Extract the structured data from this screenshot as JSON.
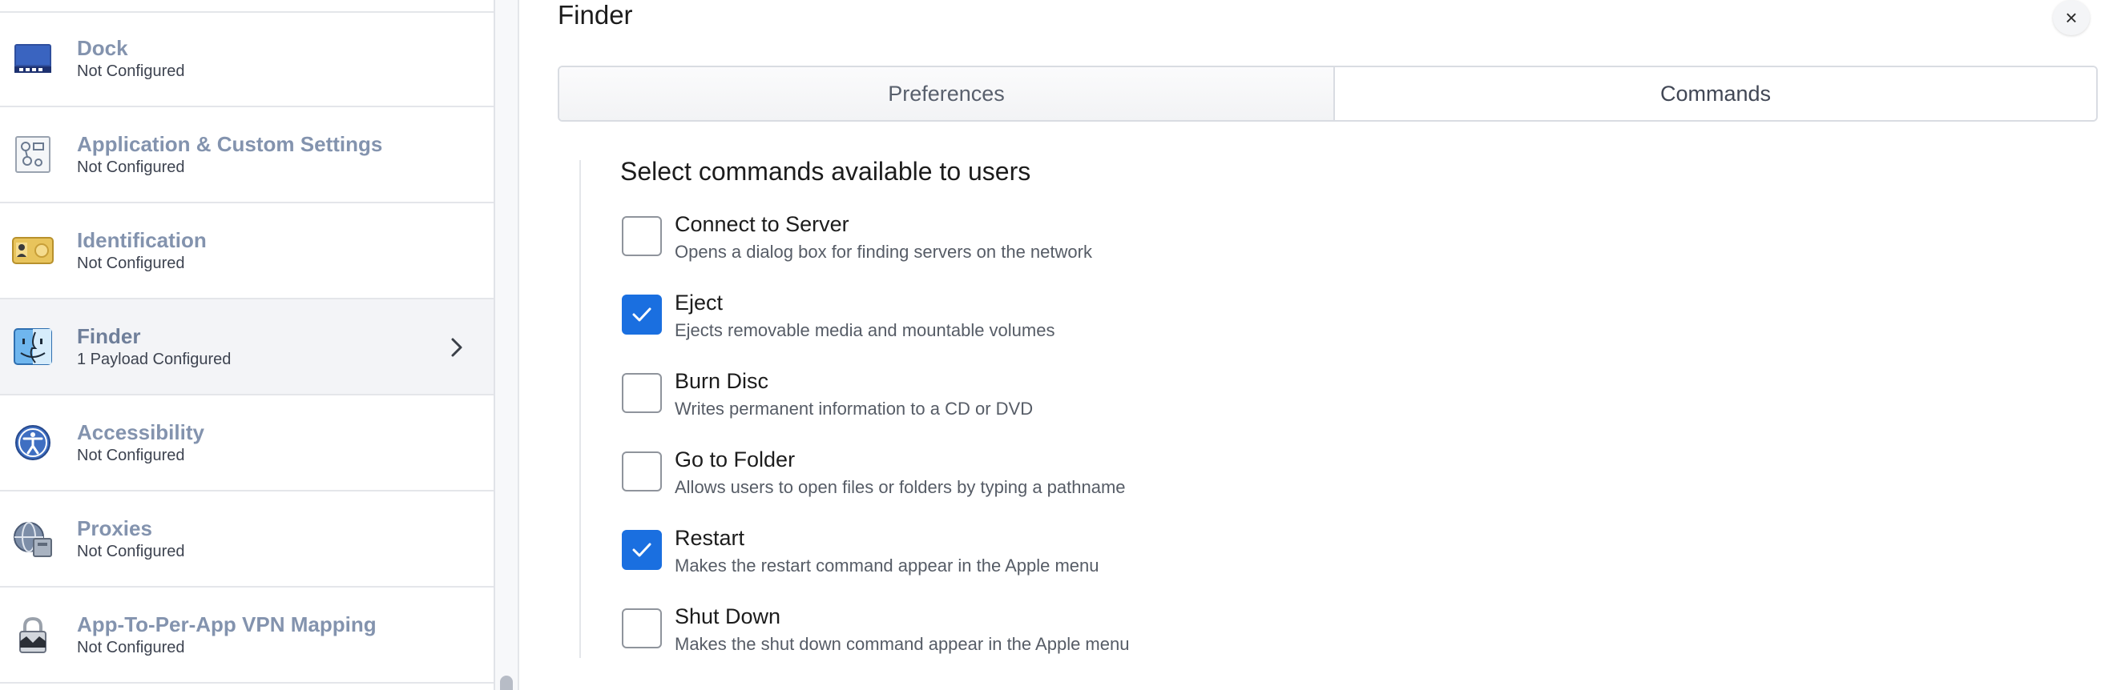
{
  "sidebar": {
    "items": [
      {
        "title": "Dock",
        "subtitle": "Not Configured",
        "icon": "dock-icon"
      },
      {
        "title": "Application & Custom Settings",
        "subtitle": "Not Configured",
        "icon": "custom-settings-icon"
      },
      {
        "title": "Identification",
        "subtitle": "Not Configured",
        "icon": "id-card-icon"
      },
      {
        "title": "Finder",
        "subtitle": "1 Payload Configured",
        "icon": "finder-icon",
        "active": true
      },
      {
        "title": "Accessibility",
        "subtitle": "Not Configured",
        "icon": "accessibility-icon"
      },
      {
        "title": "Proxies",
        "subtitle": "Not Configured",
        "icon": "proxies-globe-icon"
      },
      {
        "title": "App-To-Per-App VPN Mapping",
        "subtitle": "Not Configured",
        "icon": "lock-icon"
      }
    ]
  },
  "panel": {
    "title": "Finder",
    "close_label": "×",
    "tabs": [
      {
        "label": "Preferences",
        "selected": false
      },
      {
        "label": "Commands",
        "selected": true
      }
    ],
    "section_heading": "Select commands available to users",
    "commands": [
      {
        "label": "Connect to Server",
        "description": "Opens a dialog box for finding servers on the network",
        "checked": false
      },
      {
        "label": "Eject",
        "description": "Ejects removable media and mountable volumes",
        "checked": true
      },
      {
        "label": "Burn Disc",
        "description": "Writes permanent information to a CD or DVD",
        "checked": false
      },
      {
        "label": "Go to Folder",
        "description": "Allows users to open files or folders by typing a pathname",
        "checked": false
      },
      {
        "label": "Restart",
        "description": "Makes the restart command appear in the Apple menu",
        "checked": true
      },
      {
        "label": "Shut Down",
        "description": "Makes the shut down command appear in the Apple menu",
        "checked": false
      }
    ]
  },
  "colors": {
    "accent": "#1a6fe0",
    "sidebar_title": "#8393ae",
    "active_row_bg": "#f3f4f7"
  }
}
